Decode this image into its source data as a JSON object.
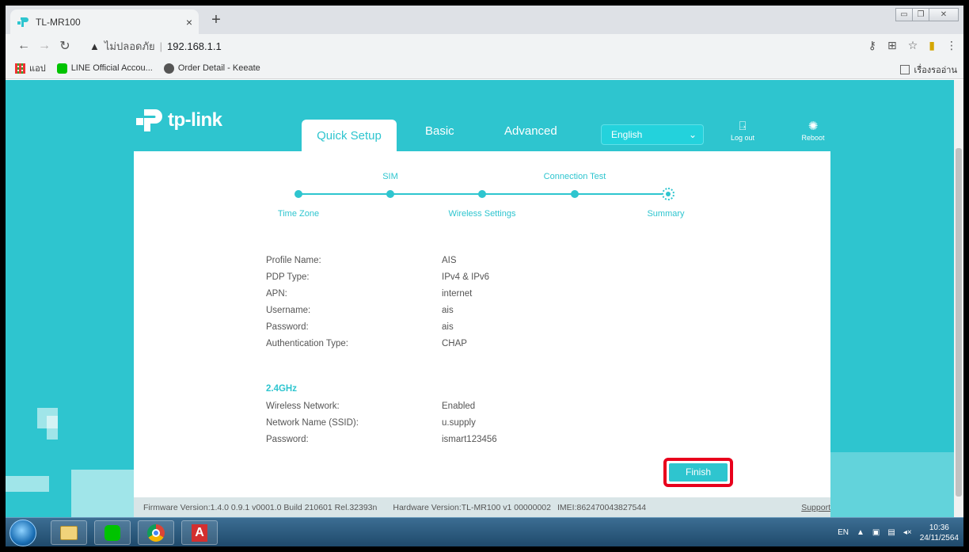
{
  "browser": {
    "tab_title": "TL-MR100",
    "tab_close": "×",
    "new_tab": "+",
    "security_label": "ไม่ปลอดภัย",
    "url": "192.168.1.1",
    "bookmarks": [
      {
        "label": "แอป"
      },
      {
        "label": "LINE Official Accou..."
      },
      {
        "label": "Order Detail - Keeate"
      }
    ],
    "reading_list": "เรื่องรออ่าน"
  },
  "header": {
    "logo_text": "tp-link",
    "tabs": [
      "Quick Setup",
      "Basic",
      "Advanced"
    ],
    "active_tab": "Quick Setup",
    "language": "English",
    "logout_label": "Log out",
    "reboot_label": "Reboot"
  },
  "stepper": {
    "top_labels": [
      "SIM",
      "Connection Test"
    ],
    "bottom_labels": [
      "Time Zone",
      "Wireless Settings",
      "Summary"
    ],
    "current_step": "Summary"
  },
  "summary": {
    "profile": [
      {
        "label": "Profile Name:",
        "value": "AIS"
      },
      {
        "label": "PDP Type:",
        "value": "IPv4 & IPv6"
      },
      {
        "label": "APN:",
        "value": "internet"
      },
      {
        "label": "Username:",
        "value": "ais"
      },
      {
        "label": "Password:",
        "value": "ais"
      },
      {
        "label": "Authentication Type:",
        "value": "CHAP"
      }
    ],
    "wireless_heading": "2.4GHz",
    "wireless": [
      {
        "label": "Wireless Network:",
        "value": "Enabled"
      },
      {
        "label": "Network Name (SSID):",
        "value": "u.supply"
      },
      {
        "label": "Password:",
        "value": "ismart123456"
      }
    ]
  },
  "actions": {
    "finish_label": "Finish"
  },
  "footer": {
    "firmware": "Firmware Version:1.4.0 0.9.1 v0001.0 Build 210601 Rel.32393n",
    "hardware": "Hardware Version:TL-MR100 v1 00000002",
    "imei": "IMEI:862470043827544",
    "support": "Support"
  },
  "taskbar": {
    "lang": "EN",
    "time": "10:36",
    "date": "24/11/2564"
  },
  "colors": {
    "accent": "#2ec5cf",
    "highlight": "#e8001c"
  }
}
